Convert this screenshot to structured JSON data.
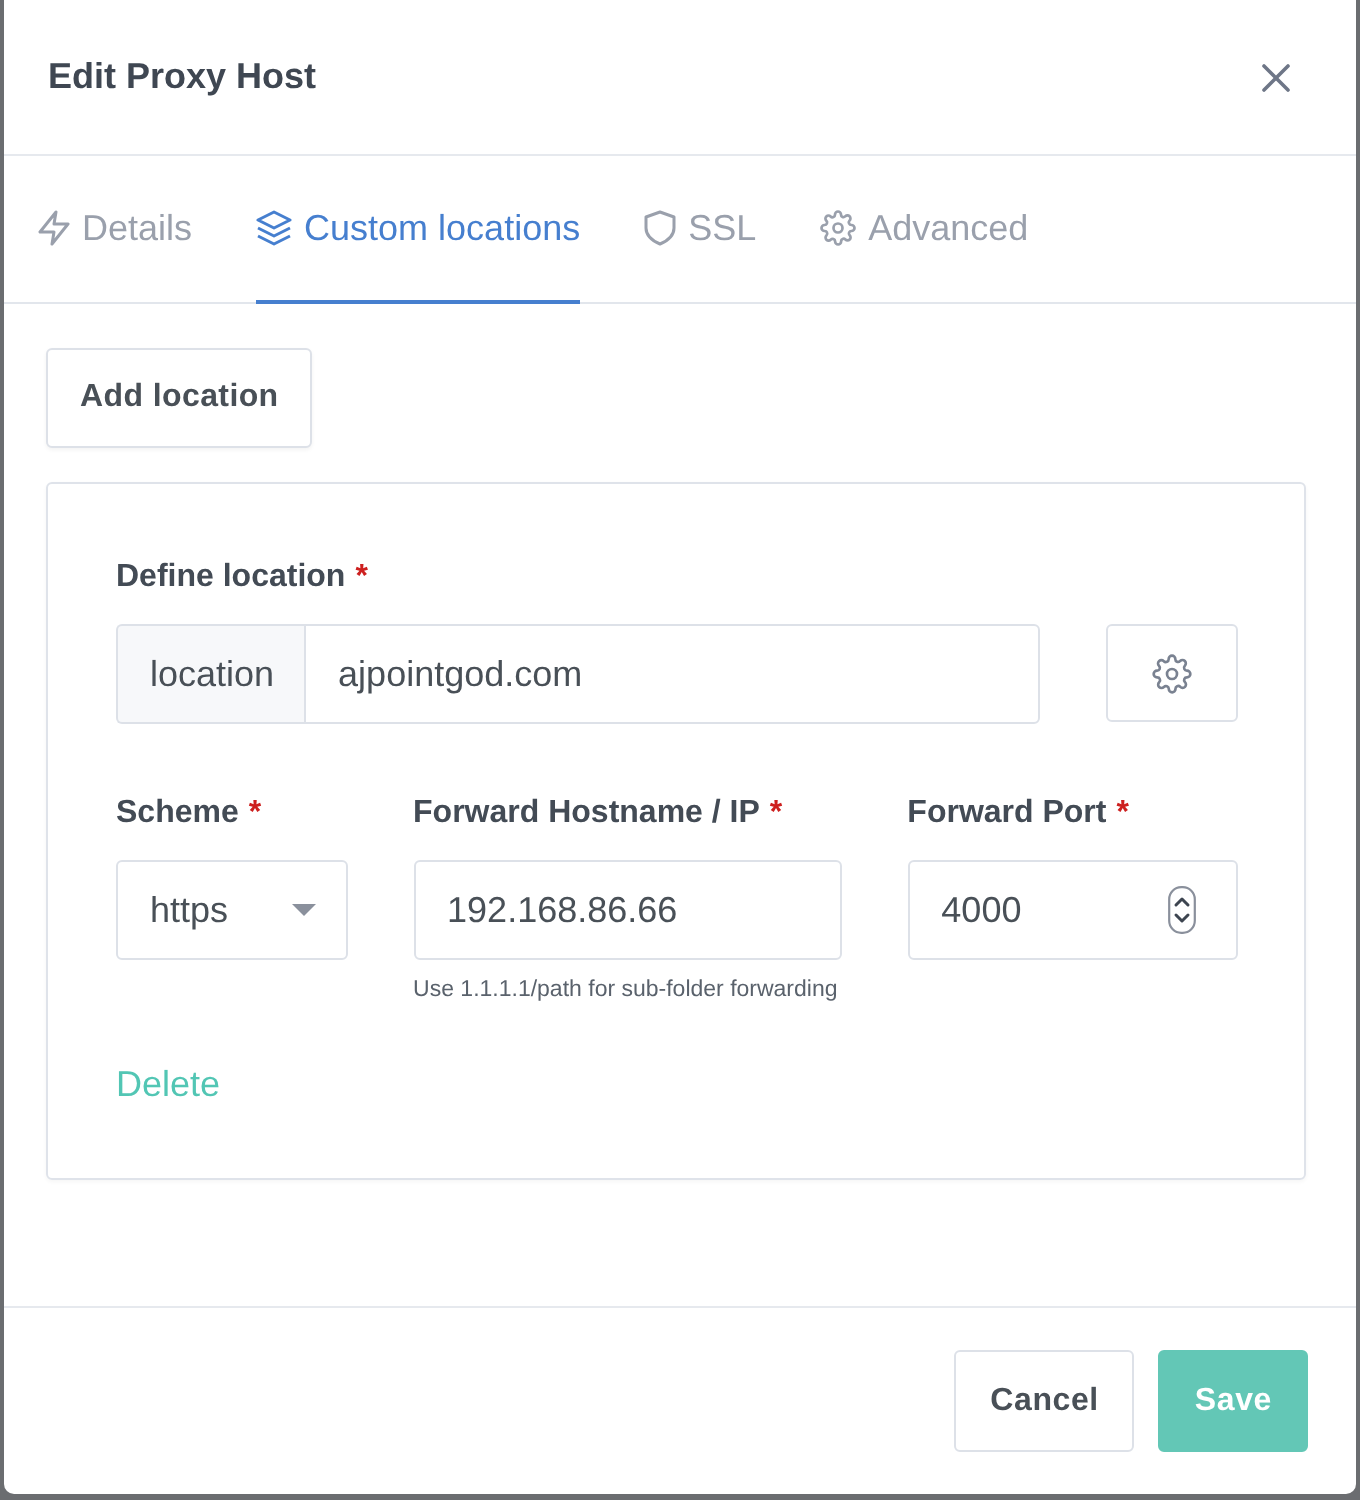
{
  "modal": {
    "title": "Edit Proxy Host"
  },
  "tabs": [
    {
      "label": "Details",
      "selected": false
    },
    {
      "label": "Custom locations",
      "selected": true
    },
    {
      "label": "SSL",
      "selected": false
    },
    {
      "label": "Advanced",
      "selected": false
    }
  ],
  "add_button": "Add location",
  "location": {
    "label": "Define location",
    "required_mark": "*",
    "prefix": "location",
    "value": "ajpointgod.com"
  },
  "fields": [
    {
      "kind": "select",
      "label": "Scheme",
      "required_mark": "*",
      "value": "https"
    },
    {
      "kind": "text",
      "label": "Forward Hostname / IP",
      "required_mark": "*",
      "value": "192.168.86.66",
      "hint": "Use 1.1.1.1/path for sub-folder forwarding"
    },
    {
      "kind": "number",
      "label": "Forward Port",
      "required_mark": "*",
      "value": "4000"
    }
  ],
  "delete_link": "Delete",
  "footer": {
    "buttons": [
      {
        "label": "Cancel",
        "kind": "secondary"
      },
      {
        "label": "Save",
        "kind": "primary"
      }
    ]
  }
}
